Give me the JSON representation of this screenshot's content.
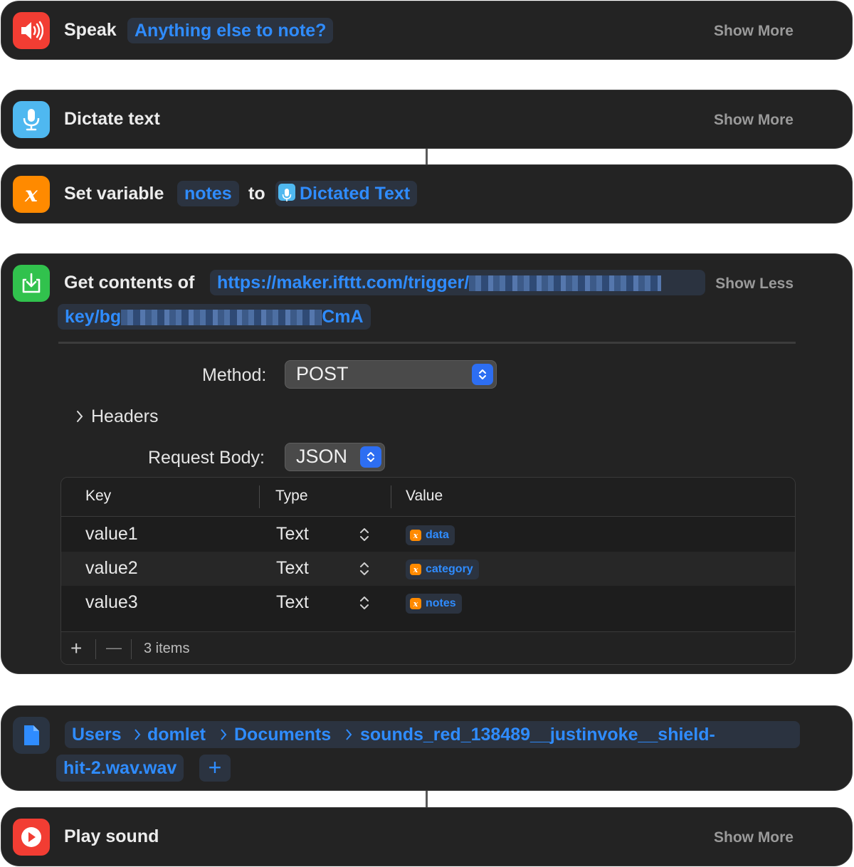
{
  "speak": {
    "title": "Speak",
    "token": "Anything else to note?",
    "show_more": "Show More"
  },
  "dictate": {
    "title": "Dictate text",
    "show_more": "Show More"
  },
  "set_variable": {
    "title": "Set variable",
    "var": "notes",
    "to": "to",
    "value": "Dictated Text"
  },
  "get_contents": {
    "title": "Get contents of",
    "url_line1": "https://maker.ifttt.com/trigger/",
    "url_line2_start": "key/bg",
    "url_line2_end": "CmA",
    "show_less": "Show Less",
    "method_label": "Method:",
    "method_value": "POST",
    "headers_label": "Headers",
    "body_label": "Request Body:",
    "body_value": "JSON",
    "table": {
      "headers": [
        "Key",
        "Type",
        "Value"
      ],
      "rows": [
        {
          "key": "value1",
          "type": "Text",
          "value": "data"
        },
        {
          "key": "value2",
          "type": "Text",
          "value": "category"
        },
        {
          "key": "value3",
          "type": "Text",
          "value": "notes"
        }
      ],
      "footer_add": "+",
      "footer_remove": "—",
      "count": "3 items"
    }
  },
  "file": {
    "path": [
      "Users",
      "domlet",
      "Documents",
      "sounds_red_138489__justinvoke__shield-"
    ],
    "path_line2": "hit-2.wav.wav",
    "add": "+"
  },
  "play_sound": {
    "title": "Play sound",
    "show_more": "Show More"
  },
  "colors": {
    "card_bg": "#232323",
    "accent_blue": "#2f8cff",
    "speak_icon": "#f23d33",
    "dictate_icon": "#4fb8f0",
    "variable_icon": "#ff8a00",
    "getcontents_icon": "#31c24d",
    "file_icon": "#2f8cff",
    "play_icon": "#f23d33"
  },
  "icons": [
    "speaker-icon",
    "microphone-icon",
    "variable-icon",
    "download-icon",
    "document-icon",
    "play-icon",
    "chevron-right-icon",
    "up-down-arrows-icon"
  ]
}
